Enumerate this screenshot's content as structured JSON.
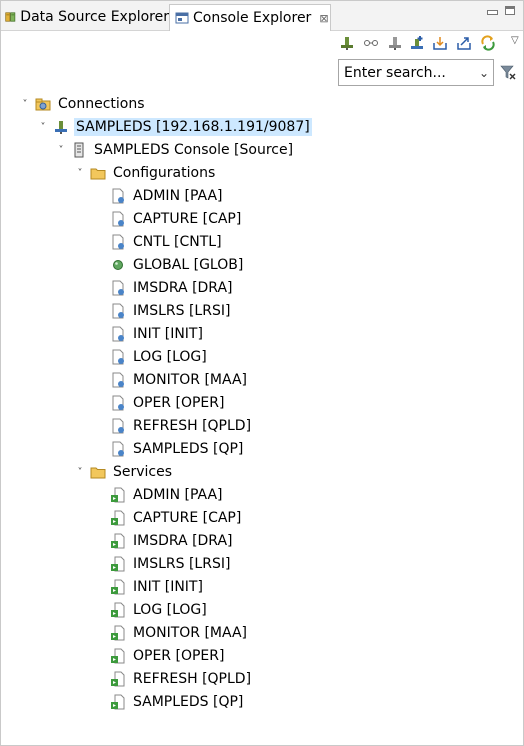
{
  "tabs": [
    {
      "label": "Data Source Explorer",
      "icon": "data-source-explorer-icon"
    },
    {
      "label": "Console Explorer",
      "icon": "console-explorer-icon",
      "close": "⊠",
      "active": true
    }
  ],
  "search": {
    "value": "Enter search..."
  },
  "tree": {
    "connections": "Connections",
    "host": "SAMPLEDS [192.168.1.191/9087]",
    "console": "SAMPLEDS Console [Source]",
    "configurations": {
      "label": "Configurations",
      "items": [
        "ADMIN [PAA]",
        "CAPTURE [CAP]",
        "CNTL [CNTL]",
        "GLOBAL [GLOB]",
        "IMSDRA [DRA]",
        "IMSLRS [LRSI]",
        "INIT [INIT]",
        "LOG [LOG]",
        "MONITOR [MAA]",
        "OPER [OPER]",
        "REFRESH [QPLD]",
        "SAMPLEDS [QP]"
      ]
    },
    "services": {
      "label": "Services",
      "items": [
        "ADMIN [PAA]",
        "CAPTURE [CAP]",
        "IMSDRA [DRA]",
        "IMSLRS [LRSI]",
        "INIT [INIT]",
        "LOG [LOG]",
        "MONITOR [MAA]",
        "OPER [OPER]",
        "REFRESH [QPLD]",
        "SAMPLEDS [QP]"
      ]
    }
  },
  "colors": {
    "selection": "#cde8ff",
    "folder": "#f2c75c",
    "service_green": "#3c9a3c"
  }
}
